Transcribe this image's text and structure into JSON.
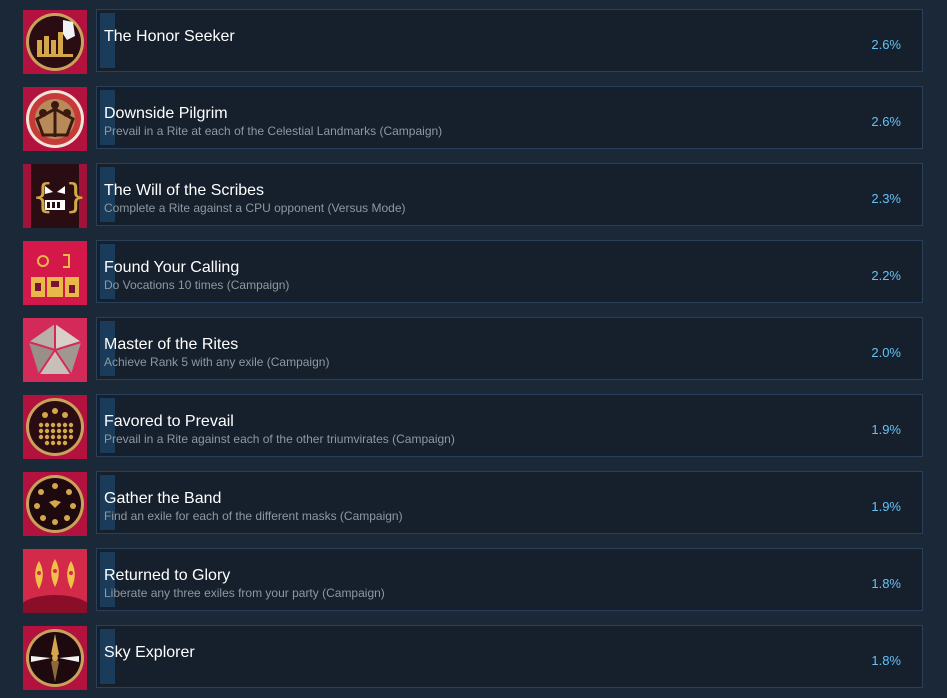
{
  "achievements": [
    {
      "title": "The Honor Seeker",
      "desc": "",
      "percent": "2.6%",
      "icon": "honor-seeker-icon"
    },
    {
      "title": "Downside Pilgrim",
      "desc": "Prevail in a Rite at each of the Celestial Landmarks (Campaign)",
      "percent": "2.6%",
      "icon": "downside-pilgrim-icon"
    },
    {
      "title": "The Will of the Scribes",
      "desc": "Complete a Rite against a CPU opponent (Versus Mode)",
      "percent": "2.3%",
      "icon": "will-of-scribes-icon"
    },
    {
      "title": "Found Your Calling",
      "desc": "Do Vocations 10 times (Campaign)",
      "percent": "2.2%",
      "icon": "found-your-calling-icon"
    },
    {
      "title": "Master of the Rites",
      "desc": "Achieve Rank 5 with any exile (Campaign)",
      "percent": "2.0%",
      "icon": "master-of-rites-icon"
    },
    {
      "title": "Favored to Prevail",
      "desc": "Prevail in a Rite against each of the other triumvirates (Campaign)",
      "percent": "1.9%",
      "icon": "favored-to-prevail-icon"
    },
    {
      "title": "Gather the Band",
      "desc": "Find an exile for each of the different masks (Campaign)",
      "percent": "1.9%",
      "icon": "gather-the-band-icon"
    },
    {
      "title": "Returned to Glory",
      "desc": "Liberate any three exiles from your party (Campaign)",
      "percent": "1.8%",
      "icon": "returned-to-glory-icon"
    },
    {
      "title": "Sky Explorer",
      "desc": "",
      "percent": "1.8%",
      "icon": "sky-explorer-icon"
    }
  ],
  "colors": {
    "background": "#1b2838",
    "panel": "#16202d",
    "border": "#2a3f5a",
    "progress": "#1a3c5a",
    "title": "#ffffff",
    "desc": "#8f98a0",
    "percent": "#66c0f4",
    "icon_red": "#b3123f",
    "icon_gold": "#d4a84a"
  }
}
